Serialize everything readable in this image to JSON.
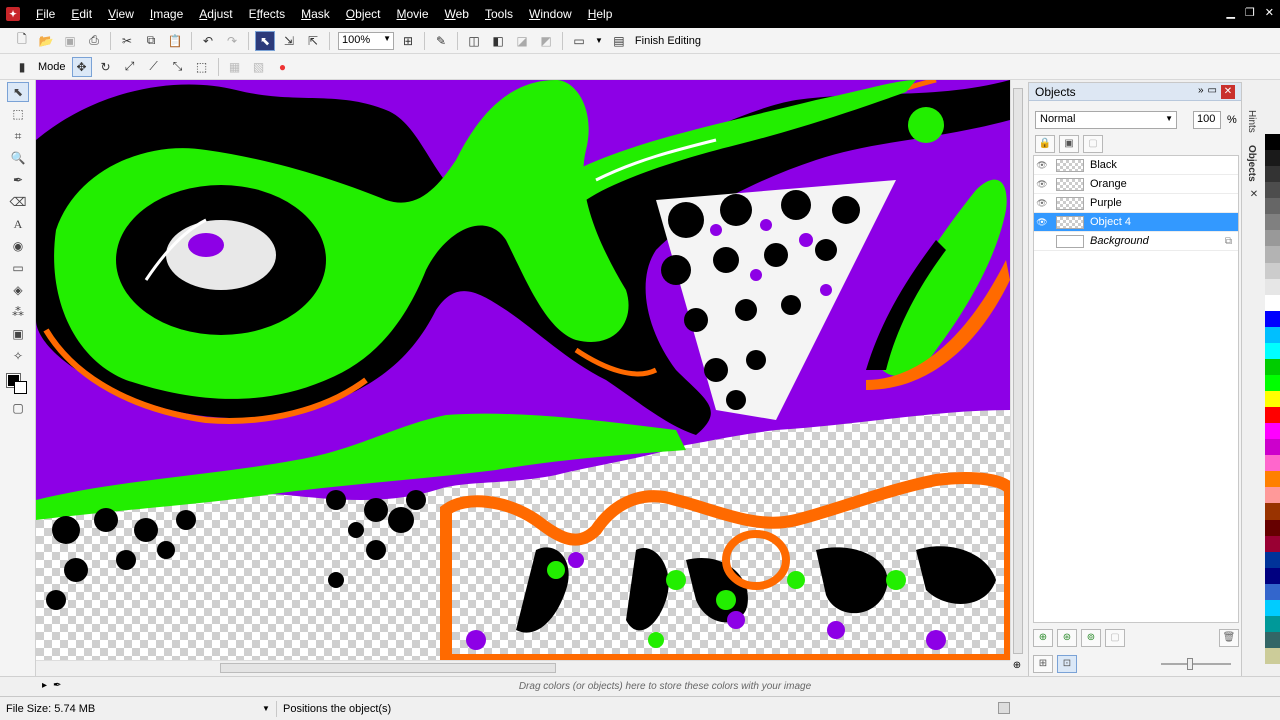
{
  "app": {
    "icon": "corel-photopaint-icon"
  },
  "menu": [
    {
      "label": "File",
      "u": "F",
      "rest": "ile"
    },
    {
      "label": "Edit",
      "u": "E",
      "rest": "dit"
    },
    {
      "label": "View",
      "u": "V",
      "rest": "iew"
    },
    {
      "label": "Image",
      "u": "I",
      "rest": "mage"
    },
    {
      "label": "Adjust",
      "u": "A",
      "rest": "djust"
    },
    {
      "label": "Effects",
      "u": "f",
      "pre": "E",
      "rest": "fects"
    },
    {
      "label": "Mask",
      "u": "M",
      "rest": "ask"
    },
    {
      "label": "Object",
      "u": "O",
      "rest": "bject"
    },
    {
      "label": "Movie",
      "u": "M",
      "rest": "ovie"
    },
    {
      "label": "Web",
      "u": "W",
      "rest": "eb"
    },
    {
      "label": "Tools",
      "u": "T",
      "rest": "ools"
    },
    {
      "label": "Window",
      "u": "W",
      "rest": "indow"
    },
    {
      "label": "Help",
      "u": "H",
      "rest": "elp"
    }
  ],
  "toolbar": {
    "zoom": "100%",
    "finish_editing": "Finish Editing",
    "mode_label": "Mode"
  },
  "colors": {
    "purple": "#8d00e6",
    "green": "#22ee00",
    "orange": "#ff6a00",
    "black": "#000000",
    "selection": "#3399ff"
  },
  "objects_panel": {
    "title": "Objects",
    "blend_mode": "Normal",
    "opacity": "100",
    "opacity_unit": "%",
    "layers": [
      {
        "name": "Black",
        "selected": false,
        "italic": false
      },
      {
        "name": "Orange",
        "selected": false,
        "italic": false
      },
      {
        "name": "Purple",
        "selected": false,
        "italic": false
      },
      {
        "name": "Object 4",
        "selected": true,
        "italic": false
      },
      {
        "name": "Background",
        "selected": false,
        "italic": true
      }
    ]
  },
  "side_tabs": [
    "Hints",
    "Objects"
  ],
  "palette": [
    "#000000",
    "#1a1a1a",
    "#333333",
    "#4d4d4d",
    "#666666",
    "#808080",
    "#999999",
    "#b3b3b3",
    "#cccccc",
    "#e6e6e6",
    "#ffffff",
    "#0000ff",
    "#00bfff",
    "#00ffff",
    "#00cc00",
    "#00ff00",
    "#ffff00",
    "#ff0000",
    "#ff00ff",
    "#cc00cc",
    "#ff66cc",
    "#ff8000",
    "#ff9999",
    "#993300",
    "#660000",
    "#990033",
    "#003399",
    "#000080",
    "#3366cc",
    "#00ccff",
    "#009999",
    "#336666",
    "#cccc99"
  ],
  "tray": {
    "hint": "Drag colors (or objects) here to store these colors with your image"
  },
  "status": {
    "file_size": "File Size: 5.74 MB",
    "message": "Positions the object(s)"
  }
}
